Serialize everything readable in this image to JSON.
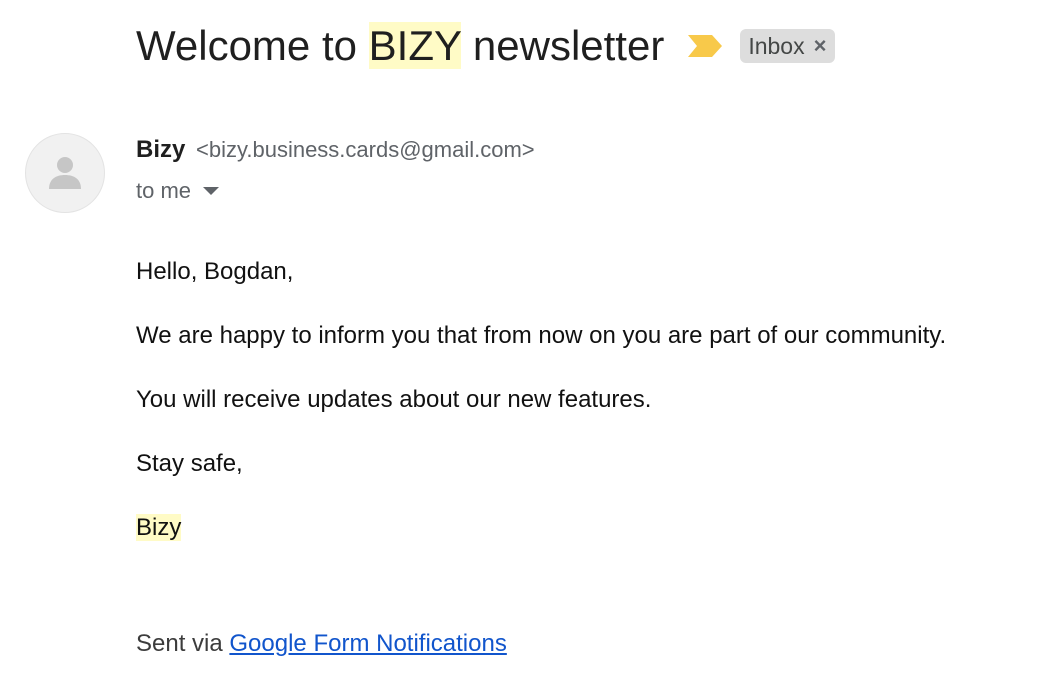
{
  "email": {
    "subject_prefix": "Welcome to ",
    "subject_highlight": "BIZY",
    "subject_suffix": " newsletter",
    "label": "Inbox",
    "label_close": "×",
    "sender_name": "Bizy",
    "sender_email": "<bizy.business.cards@gmail.com>",
    "recipient": "to me",
    "body": {
      "greeting": "Hello, Bogdan,",
      "paragraph1": "We are happy to inform you that from now on you are part of our community.",
      "paragraph2": "You will receive updates about our new features.",
      "closing": "Stay safe,",
      "signature": "Bizy"
    },
    "footer": {
      "prefix": "Sent via ",
      "link_text": "Google Form Notifications"
    }
  },
  "icons": {
    "importance": "importance-marker-icon",
    "avatar": "default-person-icon",
    "recipient_caret": "caret-down-icon"
  },
  "colors": {
    "highlight": "#fffbc6",
    "importance_marker": "#f8c94a",
    "link": "#1155cc",
    "label_chip_bg": "#dddddd"
  }
}
